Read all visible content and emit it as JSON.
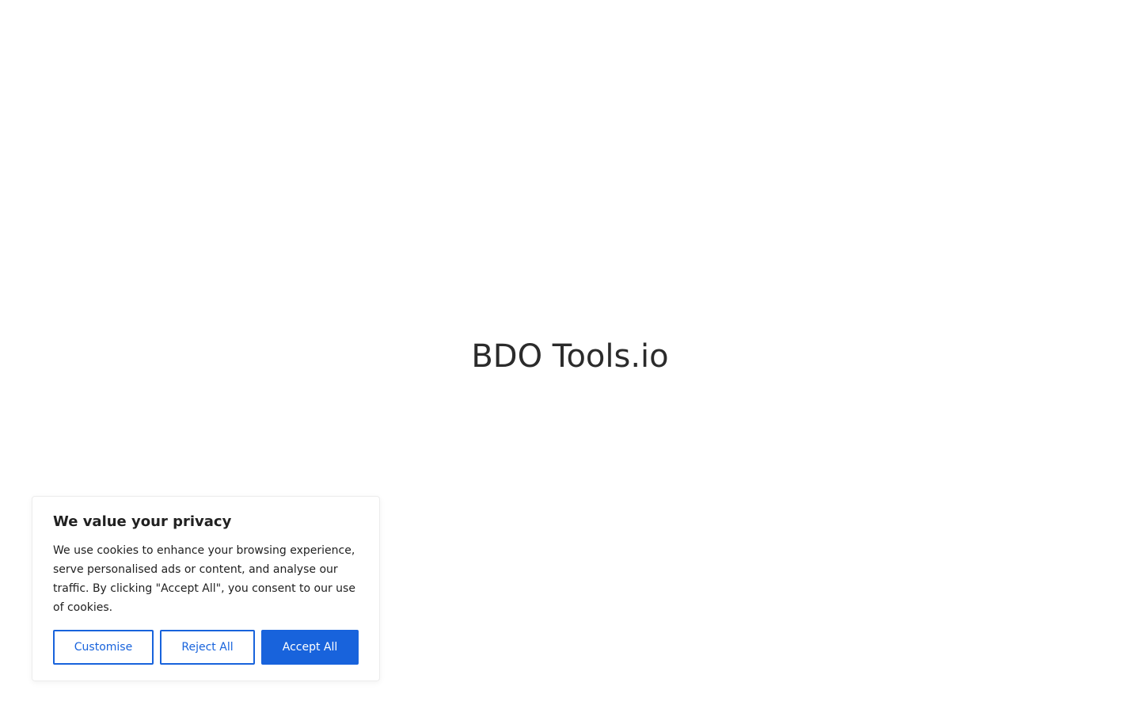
{
  "site": {
    "title": "BDO Tools.io"
  },
  "cookie_banner": {
    "title": "We value your privacy",
    "message": "We use cookies to enhance your browsing experience, serve personalised ads or content, and analyse our traffic. By clicking \"Accept All\", you consent to our use of cookies.",
    "buttons": {
      "customise": "Customise",
      "reject": "Reject All",
      "accept": "Accept All"
    }
  },
  "colors": {
    "accent": "#1863dc",
    "text": "#212121",
    "title_text": "#2b2b2b",
    "background": "#ffffff"
  }
}
